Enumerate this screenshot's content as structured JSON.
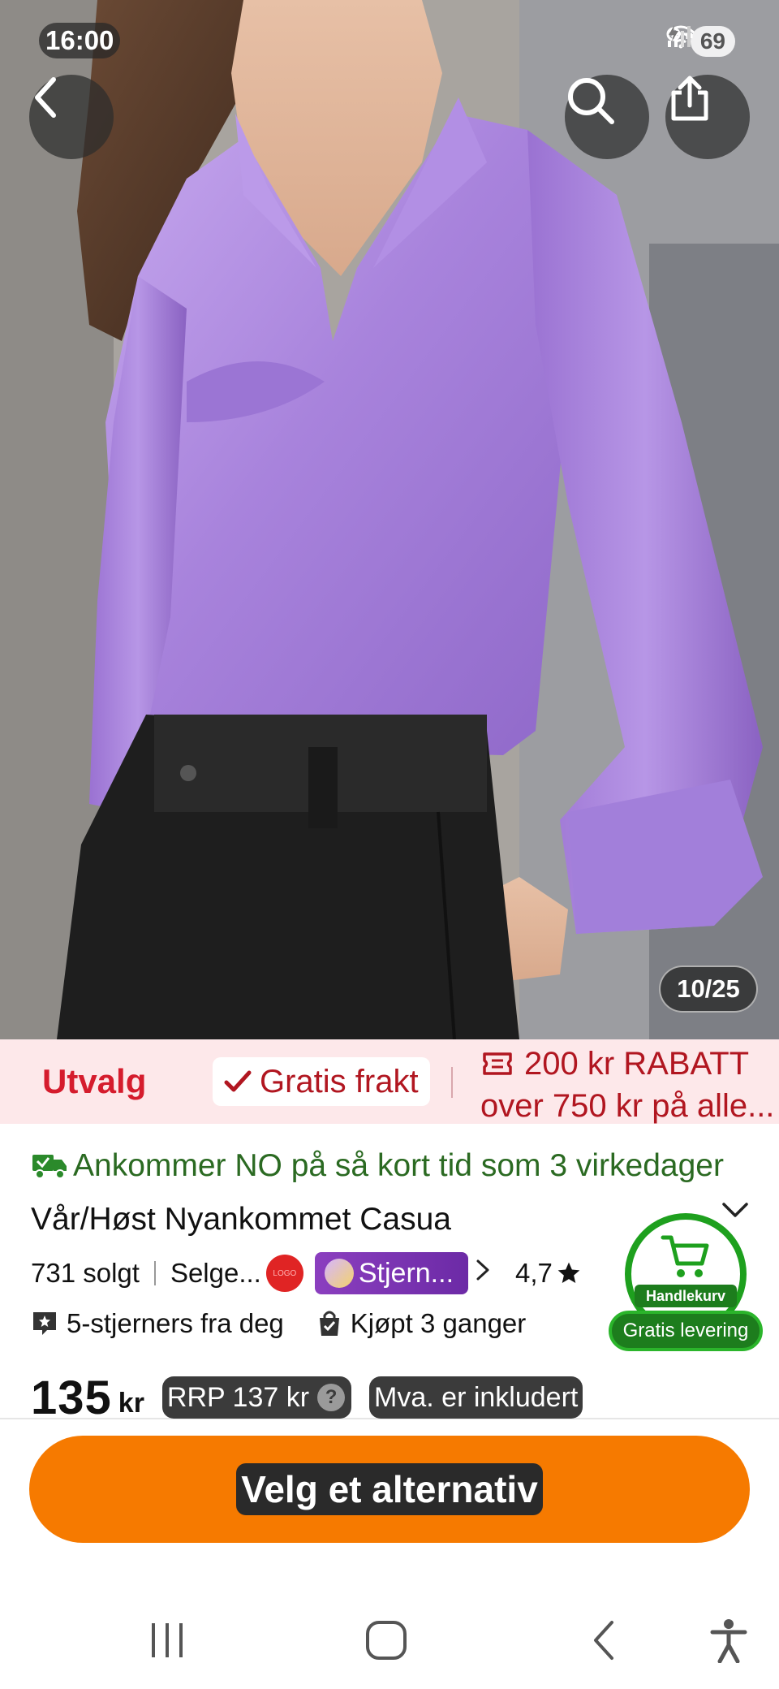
{
  "status_bar": {
    "time": "16:00",
    "battery": "69",
    "icons": [
      "vpn-key-icon",
      "wifi-icon",
      "signal-icon",
      "battery-icon"
    ]
  },
  "top_actions": {
    "back_icon": "chevron-left-icon",
    "search_icon": "search-icon",
    "share_icon": "share-icon"
  },
  "gallery": {
    "counter": "10/25"
  },
  "promo": {
    "utvalg": "Utvalg",
    "frakt": "Gratis frakt",
    "rabatt_line1": "200 kr RABATT",
    "rabatt_line2": "over 750 kr på alle..."
  },
  "product": {
    "delivery_text": "Ankommer NO på så kort tid som 3 virkedager",
    "title_rest": "Vår/Høst Nyankommet Casua",
    "sold": "731 solgt",
    "seller": "Selge...",
    "star_badge": "Stjern...",
    "rating": "4,7",
    "trust_1": "5-stjerners fra deg",
    "trust_2": "Kjøpt 3 ganger",
    "price": "135",
    "currency": "kr",
    "rrp": "RRP 137 kr",
    "mva": "Mva. er inkludert"
  },
  "cart_float": {
    "label": "Handlekurv",
    "levering": "Gratis levering"
  },
  "cta": {
    "label": "Velg et alternativ"
  },
  "nav": {
    "icons": [
      "recent-apps-icon",
      "home-icon",
      "back-icon",
      "accessibility-icon"
    ]
  },
  "colors": {
    "accent_orange": "#f67a00",
    "promo_red": "#d51c2d",
    "delivery_green": "#2b6a22",
    "blouse_lavender": "#b592e0"
  }
}
